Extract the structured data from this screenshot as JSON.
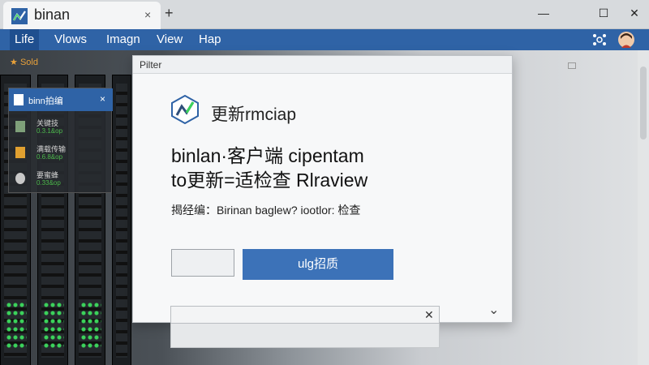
{
  "window": {
    "tab_title": "binan",
    "tab_close": "×",
    "new_tab": "+",
    "controls": {
      "minimize": "—",
      "maximize": "☐",
      "close": "✕"
    }
  },
  "menu": {
    "items": [
      "Life",
      "Vlows",
      "Imagn",
      "View",
      "Hap"
    ]
  },
  "background": {
    "sold_label": "Sold"
  },
  "side_panel": {
    "title": "binn拍编",
    "close": "×",
    "rows": [
      {
        "label": "关键技",
        "sub": "0.3.1&op"
      },
      {
        "label": "满载传输",
        "sub": "0.6.8&op"
      },
      {
        "label": "要蜜蜂",
        "sub": "0.33&op"
      }
    ]
  },
  "dialog": {
    "title": "Pilter",
    "product_name": "更新rmciap",
    "heading_line1": "binlan·客户端 cipentam",
    "heading_line2": "to更新=适检查 Rlraview",
    "info": "揭经编：Birinan  baglew?  iootlor:  检查",
    "primary_button": "ulg招质"
  },
  "input_bar": {
    "clear": "✕"
  },
  "colors": {
    "accent": "#2f63a6",
    "primary_button": "#3c72b8",
    "led_green": "#3bd35b"
  }
}
